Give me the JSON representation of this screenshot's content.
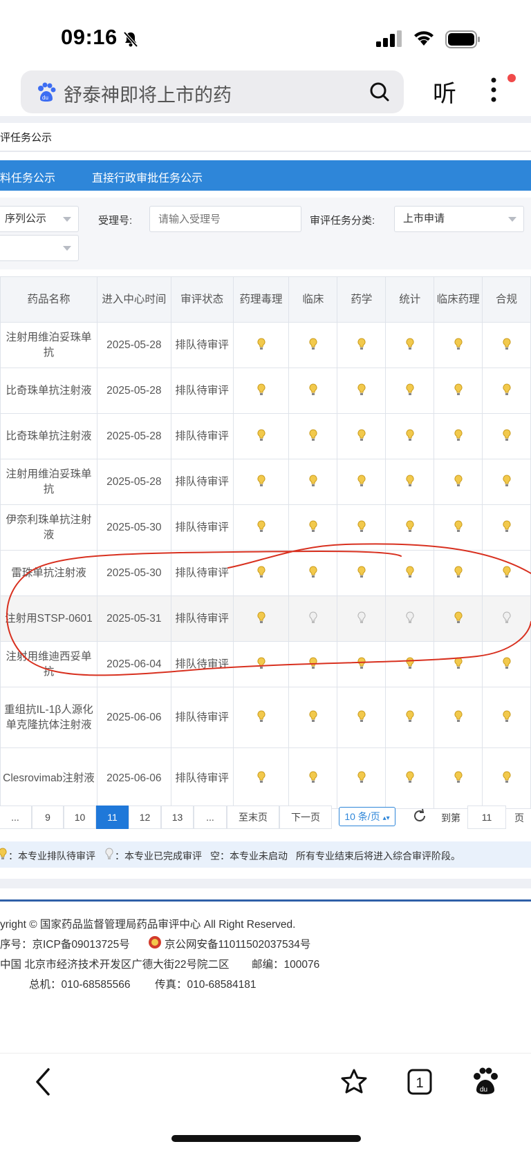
{
  "status_bar": {
    "time": "09:16"
  },
  "search": {
    "query": "舒泰神即将上市的药",
    "listen_label": "听"
  },
  "page": {
    "title": "评任务公示",
    "tabs": [
      "料任务公示",
      "直接行政审批任务公示"
    ]
  },
  "filters": {
    "sequence_select": "序列公示",
    "accept_label": "受理号:",
    "accept_placeholder": "请输入受理号",
    "category_label": "审评任务分类:",
    "category_value": "上市申请",
    "second_select": ""
  },
  "table": {
    "headers": [
      "药品名称",
      "进入中心时间",
      "审评状态",
      "药理毒理",
      "临床",
      "药学",
      "统计",
      "临床药理",
      "合规"
    ],
    "rows": [
      {
        "name": "注射用维泊妥珠单抗",
        "date": "2025-05-28",
        "status": "排队待审评",
        "review": [
          "pending",
          "pending",
          "pending",
          "pending",
          "pending",
          "pending"
        ]
      },
      {
        "name": "比奇珠单抗注射液",
        "date": "2025-05-28",
        "status": "排队待审评",
        "review": [
          "pending",
          "pending",
          "pending",
          "pending",
          "pending",
          "pending"
        ]
      },
      {
        "name": "比奇珠单抗注射液",
        "date": "2025-05-28",
        "status": "排队待审评",
        "review": [
          "pending",
          "pending",
          "pending",
          "pending",
          "pending",
          "pending"
        ]
      },
      {
        "name": "注射用维泊妥珠单抗",
        "date": "2025-05-28",
        "status": "排队待审评",
        "review": [
          "pending",
          "pending",
          "pending",
          "pending",
          "pending",
          "pending"
        ]
      },
      {
        "name": "伊奈利珠单抗注射液",
        "date": "2025-05-30",
        "status": "排队待审评",
        "review": [
          "pending",
          "pending",
          "pending",
          "pending",
          "pending",
          "pending"
        ]
      },
      {
        "name": "雷珠单抗注射液",
        "date": "2025-05-30",
        "status": "排队待审评",
        "review": [
          "pending",
          "pending",
          "pending",
          "pending",
          "pending",
          "pending"
        ]
      },
      {
        "name": "注射用STSP-0601",
        "date": "2025-05-31",
        "status": "排队待审评",
        "review": [
          "pending",
          "done",
          "done",
          "done",
          "pending",
          "done"
        ]
      },
      {
        "name": "注射用维迪西妥单抗",
        "date": "2025-06-04",
        "status": "排队待审评",
        "review": [
          "pending",
          "pending",
          "pending",
          "pending",
          "pending",
          "pending"
        ]
      },
      {
        "name": "重组抗IL-1β人源化单克隆抗体注射液",
        "date": "2025-06-06",
        "status": "排队待审评",
        "review": [
          "pending",
          "pending",
          "pending",
          "pending",
          "pending",
          "pending"
        ]
      },
      {
        "name": "Clesrovimab注射液",
        "date": "2025-06-06",
        "status": "排队待审评",
        "review": [
          "pending",
          "pending",
          "pending",
          "pending",
          "pending",
          "pending"
        ]
      }
    ]
  },
  "pagination": {
    "pages": [
      "...",
      "9",
      "10",
      "11",
      "12",
      "13",
      "..."
    ],
    "current": "11",
    "last_label": "至末页",
    "next_label": "下一页",
    "page_size": "10 条/页",
    "goto_label": "到第",
    "goto_value": "11",
    "page_suffix": "页"
  },
  "legend": {
    "pending": "：本专业排队待审评",
    "done": "：本专业已完成审评",
    "empty": "空：本专业未启动",
    "note": "所有专业结束后将进入综合审评阶段。"
  },
  "footer": {
    "copyright": "yright © 国家药品监督管理局药品审评中心    All Right Reserved.",
    "icp": "序号：京ICP备09013725号",
    "police": "京公网安备11011502037534号",
    "address": "中国  北京市经济技术开发区广德大街22号院二区",
    "postcode": "邮编：100076",
    "phone": "总机：010-68585566",
    "fax": "传真：010-68584181"
  },
  "colors": {
    "accent": "#2e86d9",
    "pending_bulb": "#f2c94c",
    "done_bulb": "#d8d8d8",
    "annotation": "#d8301f"
  },
  "icons": [
    "bell-slash-icon",
    "signal-icon",
    "wifi-icon",
    "battery-icon",
    "baidu-logo-icon",
    "search-icon",
    "more-icon",
    "back-icon",
    "star-icon",
    "tabs-icon",
    "baidu-paw-icon",
    "refresh-icon"
  ]
}
